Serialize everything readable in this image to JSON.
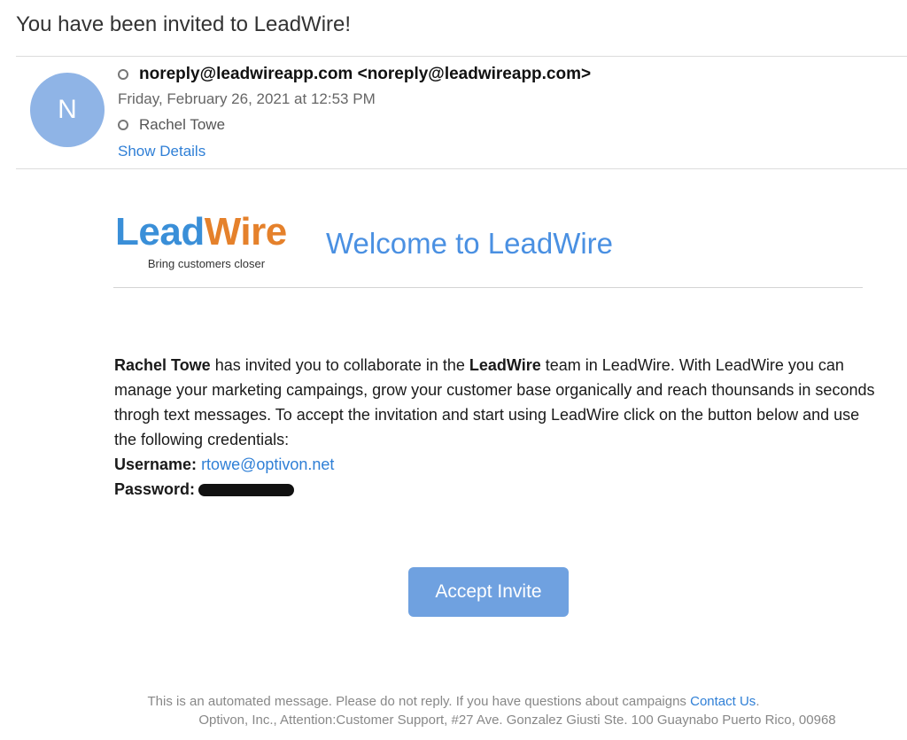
{
  "subject": "You have been invited to LeadWire!",
  "sender": {
    "avatar_letter": "N",
    "from": "noreply@leadwireapp.com <noreply@leadwireapp.com>",
    "date": "Friday, February 26, 2021 at 12:53 PM",
    "to": "Rachel Towe",
    "show_details": "Show Details"
  },
  "logo": {
    "part1": "Lead",
    "part2": "Wire",
    "tagline": "Bring customers closer"
  },
  "welcome": "Welcome to LeadWire",
  "body": {
    "inviter": "Rachel Towe",
    "text1": " has invited you to collaborate in the ",
    "team": "LeadWire",
    "text2": " team in LeadWire. With LeadWire you can manage your marketing campaings, grow your customer base organically and reach thounsands in seconds throgh text messages. To accept the invitation and start using LeadWire click on the button below and use the following credentials:",
    "username_label": "Username:",
    "username_value": "rtowe@optivon.net",
    "password_label": "Password:"
  },
  "accept_button": "Accept Invite",
  "footer": {
    "line1": "This is an automated message. Please do not reply. If you have questions about campaigns ",
    "contact_link": "Contact Us",
    "line1_end": ".",
    "line2": "Optivon, Inc., Attention:Customer Support, #27 Ave. Gonzalez Giusti Ste. 100 Guaynabo Puerto Rico, 00968"
  },
  "colors": {
    "link": "#2f7fd6",
    "logo_lead": "#3a8fd8",
    "logo_wire": "#e5812b",
    "button": "#6fa1e0",
    "avatar": "#8fb4e6"
  }
}
